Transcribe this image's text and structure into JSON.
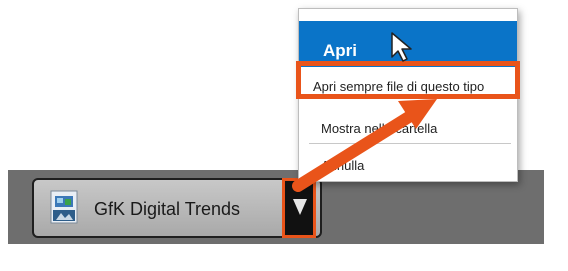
{
  "download": {
    "file_name": "GfK Digital Trends",
    "file_icon": "document-app-icon",
    "dropdown_icon": "triangle-down-icon"
  },
  "context_menu": {
    "items": [
      {
        "label": "Apri"
      },
      {
        "label": "Apri sempre file di questo tipo"
      },
      {
        "label": "Mostra nella cartella"
      },
      {
        "label": "Annulla"
      }
    ]
  },
  "colors": {
    "menu_highlight": "#0a74c8",
    "annotation": "#e9541a",
    "download_bar": "#6e6e6e"
  }
}
